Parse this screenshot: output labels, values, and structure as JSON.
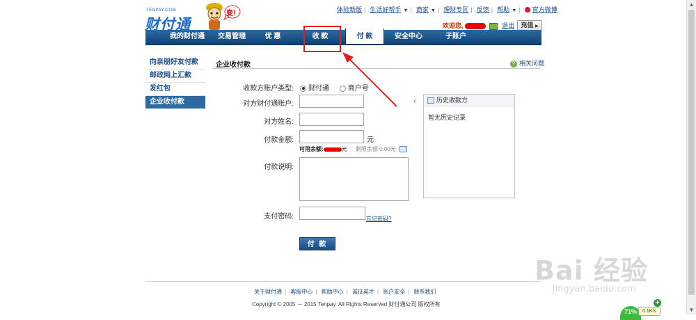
{
  "header": {
    "logo_small": "TENPAY.COM",
    "logo_text": "财付通",
    "mascot_badge": "变!",
    "top_links": [
      {
        "label": "体验新版",
        "dropdown": false
      },
      {
        "label": "生活好帮手",
        "dropdown": true
      },
      {
        "label": "商家",
        "dropdown": true
      },
      {
        "label": "理财专区",
        "dropdown": false
      },
      {
        "label": "反馈",
        "dropdown": false
      },
      {
        "label": "帮助",
        "dropdown": true
      },
      {
        "label": "官方微博",
        "dropdown": false
      }
    ],
    "welcome_label": "欢迎您,",
    "logout_label": "退出",
    "recharge_label": "充值"
  },
  "nav": {
    "tabs": [
      {
        "label": "我的财付通"
      },
      {
        "label": "交易管理"
      },
      {
        "label": "优  惠"
      },
      {
        "label": "收  款"
      },
      {
        "label": "付  款"
      },
      {
        "label": "安全中心"
      },
      {
        "label": "子账户"
      }
    ],
    "active_index": 4
  },
  "sidebar": {
    "items": [
      {
        "label": "向亲朋好友付款"
      },
      {
        "label": "邮政网上汇款"
      },
      {
        "label": "发红包"
      },
      {
        "label": "企业收付款"
      }
    ],
    "active_index": 3
  },
  "main": {
    "title": "企业收付款",
    "related_label": "相关问题",
    "form": {
      "account_type_label": "收款方账户类型:",
      "account_type_options": [
        "财付通",
        "商户号"
      ],
      "account_type_selected": "财付通",
      "account_label": "对方财付通账户:",
      "name_label": "对方姓名:",
      "amount_label": "付款金额:",
      "amount_unit": "元",
      "available_label": "可用余额:",
      "available_unit": "元",
      "limit_label": "剩限余额:",
      "limit_value": "0.00元",
      "note_label": "付款说明:",
      "password_label": "支付密码:",
      "forgot_label": "忘记密码?",
      "submit_label": "付 款"
    },
    "history": {
      "title": "历史收款方",
      "empty_text": "暂无历史记录"
    }
  },
  "footer": {
    "links": [
      "关于财付通",
      "客服中心",
      "帮助中心",
      "诚征英才",
      "账户安全",
      "联系我们"
    ],
    "copyright": "Copyright © 2005 － 2015 Tenpay. All Rights Reserved  财付通公司  版权所有"
  },
  "watermark": {
    "brand": "Bai 经验",
    "domain": "jingyan.baidu.com"
  },
  "speed_widget": {
    "percent": "71%",
    "rate": "0.1K/s"
  },
  "colors": {
    "nav_blue": "#1b5a94",
    "highlight_red": "#e02020",
    "link_blue": "#1b4f8a"
  }
}
